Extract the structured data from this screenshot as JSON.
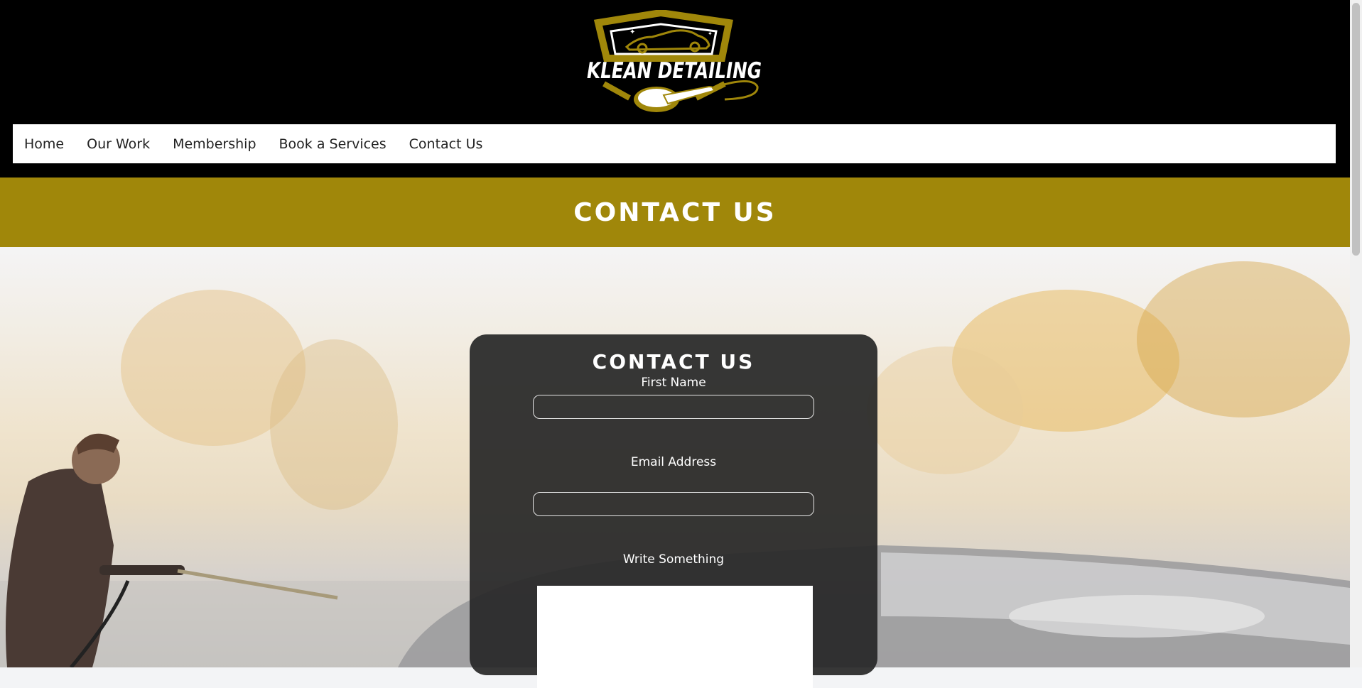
{
  "logo": {
    "text": "KLEAN DETAILING",
    "colors": {
      "gold": "#a0870a",
      "white": "#ffffff"
    }
  },
  "nav": {
    "items": [
      {
        "label": "Home"
      },
      {
        "label": "Our Work"
      },
      {
        "label": "Membership"
      },
      {
        "label": "Book a Services"
      },
      {
        "label": "Contact Us"
      }
    ]
  },
  "banner": {
    "title": "CONTACT US",
    "color": "#a0870a"
  },
  "form": {
    "title": "CONTACT US",
    "first_name_label": "First Name",
    "first_name_value": "",
    "email_label": "Email Address",
    "email_value": "",
    "message_label": "Write Something",
    "message_value": ""
  }
}
